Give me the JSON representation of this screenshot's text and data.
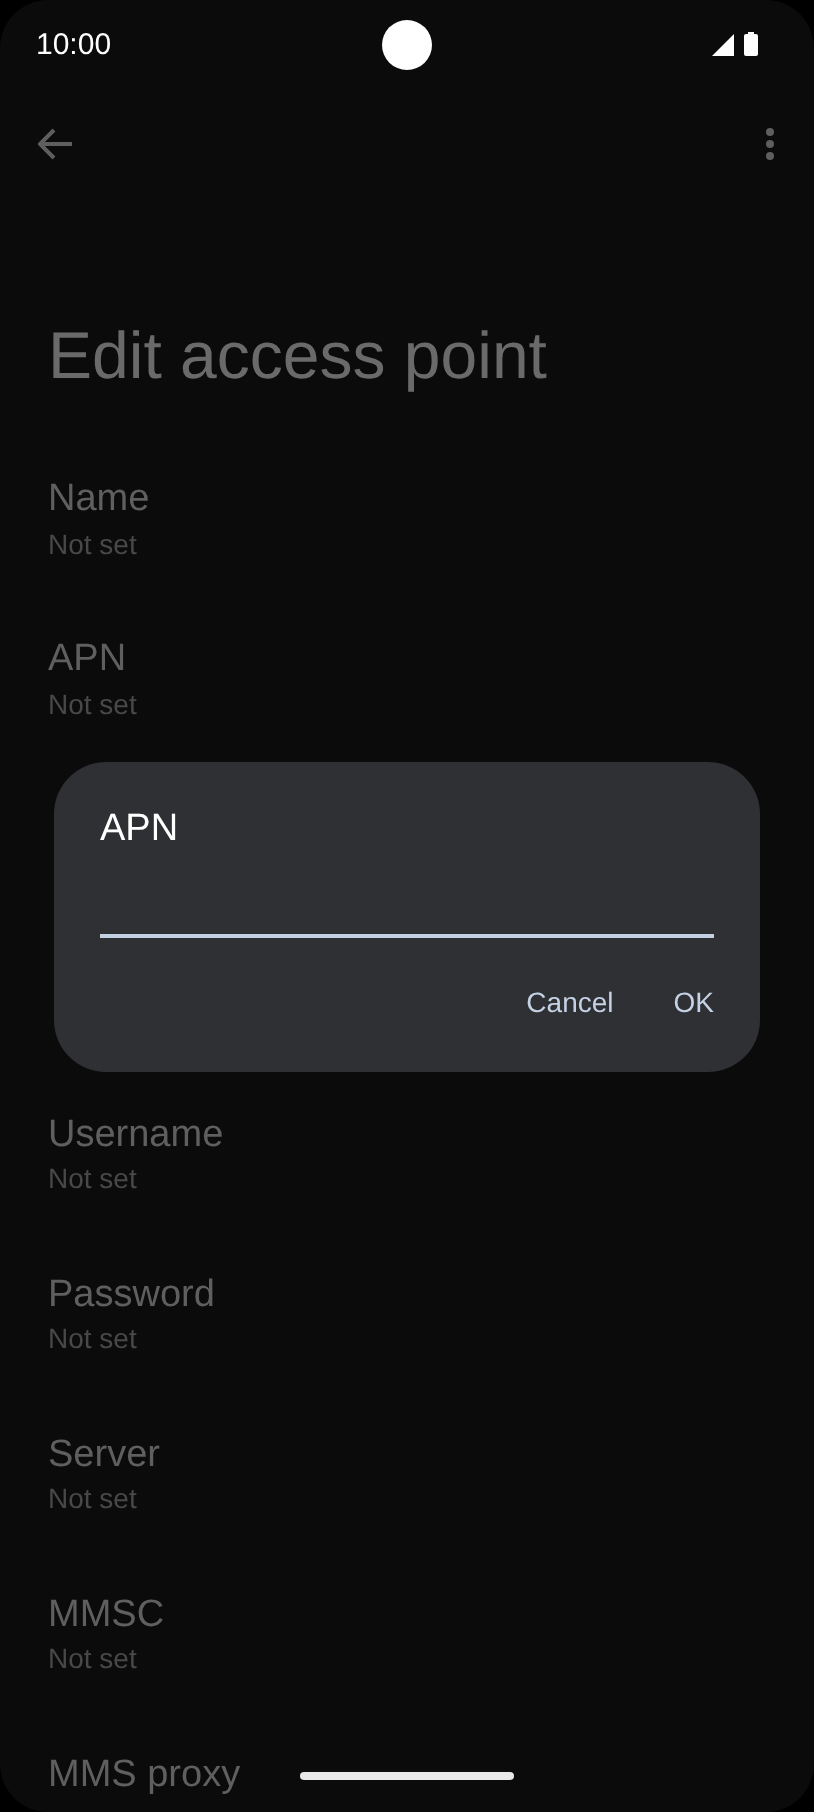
{
  "status_bar": {
    "time": "10:00"
  },
  "page": {
    "title": "Edit access point"
  },
  "fields": [
    {
      "label": "Name",
      "value": "Not set"
    },
    {
      "label": "APN",
      "value": "Not set"
    }
  ],
  "dialog": {
    "title": "APN",
    "buttons": [
      "Cancel",
      "OK"
    ]
  },
  "fields_below_dialog": [
    {
      "label": "Username",
      "value": "Not set"
    },
    {
      "label": "Password",
      "value": "Not set"
    },
    {
      "label": "Server",
      "value": "Not set"
    },
    {
      "label": "MMSC",
      "value": "Not set"
    },
    {
      "label": "MMS proxy"
    }
  ]
}
